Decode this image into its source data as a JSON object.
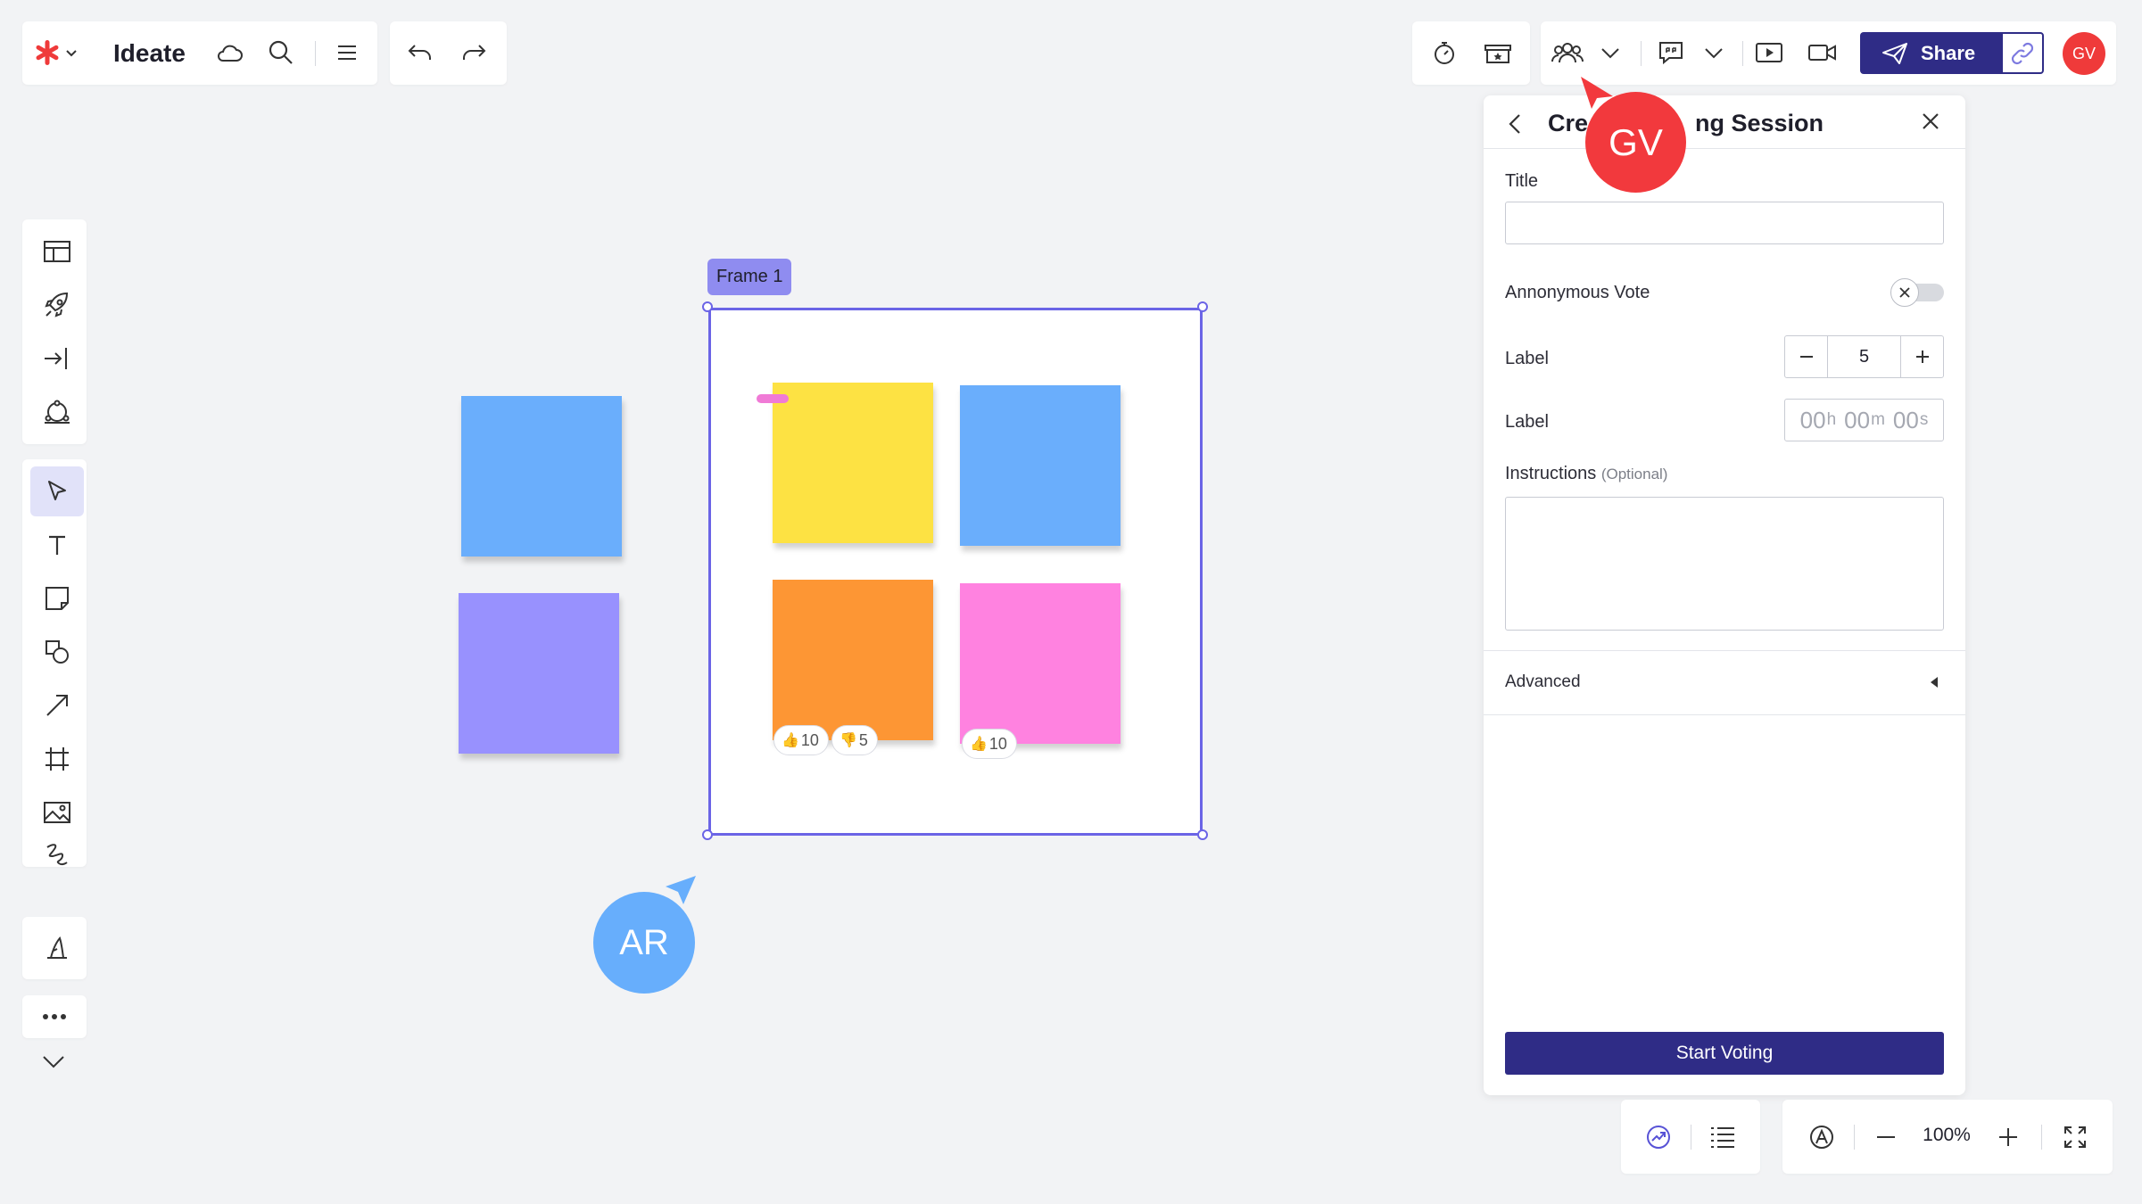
{
  "app": {
    "name": "Ideate",
    "logo": "asterisk-logo",
    "brand_color": "#ef3a3a",
    "accent_color": "#2f2c86"
  },
  "toolbar_right": {
    "share_label": "Share",
    "user_initials": "GV"
  },
  "canvas": {
    "frame_label": "Frame 1",
    "stickies": [
      {
        "color": "#6aaefc",
        "where": "outside"
      },
      {
        "color": "#9891fe",
        "where": "outside"
      },
      {
        "color": "#fde243",
        "where": "frame"
      },
      {
        "color": "#6aaefc",
        "where": "frame"
      },
      {
        "color": "#fd9634",
        "where": "frame"
      },
      {
        "color": "#ff82e0",
        "where": "frame"
      }
    ],
    "votes": {
      "orange_up": "10",
      "orange_down": "5",
      "pink_up": "10"
    },
    "cursors": {
      "gv_label": "GV",
      "gv_color": "#f2393d",
      "ar_label": "AR",
      "ar_color": "#67aefc"
    }
  },
  "voting_panel": {
    "title_visible_left": "Cre",
    "title_visible_right": "ng Session",
    "title_field_label": "Title",
    "title_value": "",
    "anonymous_label": "Annonymous Vote",
    "anonymous_on": false,
    "votes_label": "Label",
    "votes_value": "5",
    "timer_label": "Label",
    "timer_placeholder_h": "00",
    "timer_unit_h": "h",
    "timer_placeholder_m": "00",
    "timer_unit_m": "m",
    "timer_placeholder_s": "00",
    "timer_unit_s": "s",
    "instructions_label": "Instructions",
    "instructions_optional": "(Optional)",
    "instructions_value": "",
    "advanced_label": "Advanced",
    "start_button": "Start Voting"
  },
  "bottom_bar": {
    "zoom": "100%"
  }
}
